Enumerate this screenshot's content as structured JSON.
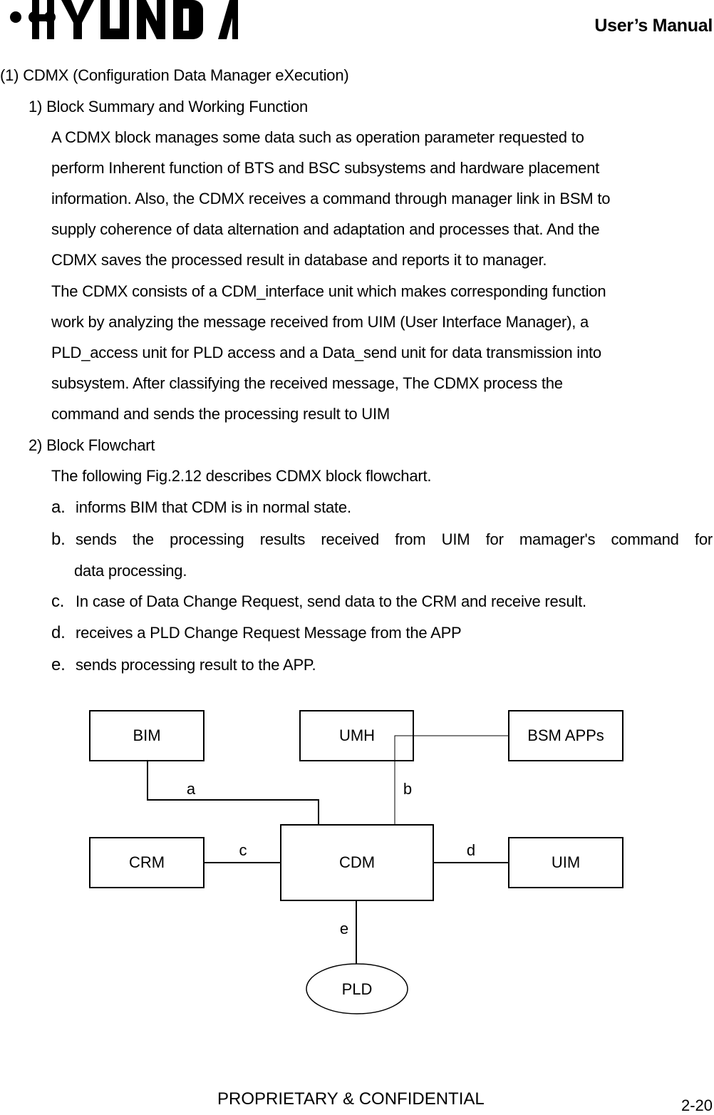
{
  "header": {
    "brand": "HYUNDAI",
    "manual_title": "User’s Manual"
  },
  "section": {
    "heading": "(1) CDMX (Configuration Data Manager eXecution)",
    "subsection1": {
      "heading": "1) Block Summary and Working Function",
      "lines": [
        "A CDMX block manages some data such as operation parameter requested to",
        "perform Inherent function of BTS and BSC subsystems and hardware placement",
        "information. Also, the CDMX receives a command through manager link in BSM to",
        "supply coherence of data alternation and adaptation and processes that. And the",
        "CDMX saves the processed result in database and reports it to manager.",
        "The CDMX consists of a CDM_interface unit which makes corresponding function",
        "work by analyzing the message received from UIM (User Interface Manager), a",
        "PLD_access unit for PLD access and a Data_send unit for data transmission into",
        "subsystem. After classifying the received message, The CDMX process the",
        "command and sends the processing result to UIM"
      ]
    },
    "subsection2": {
      "heading": "2) Block Flowchart",
      "intro": "The following Fig.2.12 describes CDMX block flowchart.",
      "items": [
        {
          "label": "a.",
          "text": "informs BIM that CDM is in normal state."
        },
        {
          "label": "b.",
          "text": "sends the processing results received from UIM for mamager's command for",
          "continuation": "data processing."
        },
        {
          "label": "c.",
          "text": "In case of Data Change Request, send data to the CRM and receive result."
        },
        {
          "label": "d.",
          "text": "receives a PLD Change Request Message from the APP"
        },
        {
          "label": "e.",
          "text": "sends processing result to the APP."
        }
      ]
    }
  },
  "diagram": {
    "nodes": {
      "bim": "BIM",
      "umh": "UMH",
      "bsm_apps": "BSM APPs",
      "crm": "CRM",
      "cdm": "CDM",
      "uim": "UIM",
      "pld": "PLD"
    },
    "edges": {
      "a": "a",
      "b": "b",
      "c": "c",
      "d": "d",
      "e": "e"
    }
  },
  "footer": {
    "confidential": "PROPRIETARY & CONFIDENTIAL",
    "page_number": "2-20"
  }
}
